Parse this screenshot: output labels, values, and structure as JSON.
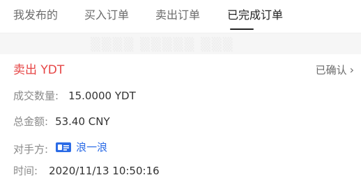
{
  "tabs": [
    {
      "label": "我发布的",
      "active": false
    },
    {
      "label": "买入订单",
      "active": false
    },
    {
      "label": "卖出订单",
      "active": false
    },
    {
      "label": "已完成订单",
      "active": true
    }
  ],
  "order": {
    "title": "卖出 YDT",
    "status": "已确认",
    "fields": {
      "quantity": {
        "label": "成交数量:",
        "value": "15.0000 YDT"
      },
      "total": {
        "label": "总金额:",
        "value": "53.40 CNY"
      },
      "counterparty": {
        "label": "对手方:",
        "value": "浪一浪"
      },
      "time": {
        "label": "时间:",
        "value": "2020/11/13 10:50:16"
      }
    }
  },
  "colors": {
    "sell_red": "#e64545",
    "link_blue": "#2b6be6",
    "active_tab": "#222222"
  },
  "icons": {
    "counterparty": "id-card-icon",
    "status_arrow": "chevron-right-icon"
  }
}
